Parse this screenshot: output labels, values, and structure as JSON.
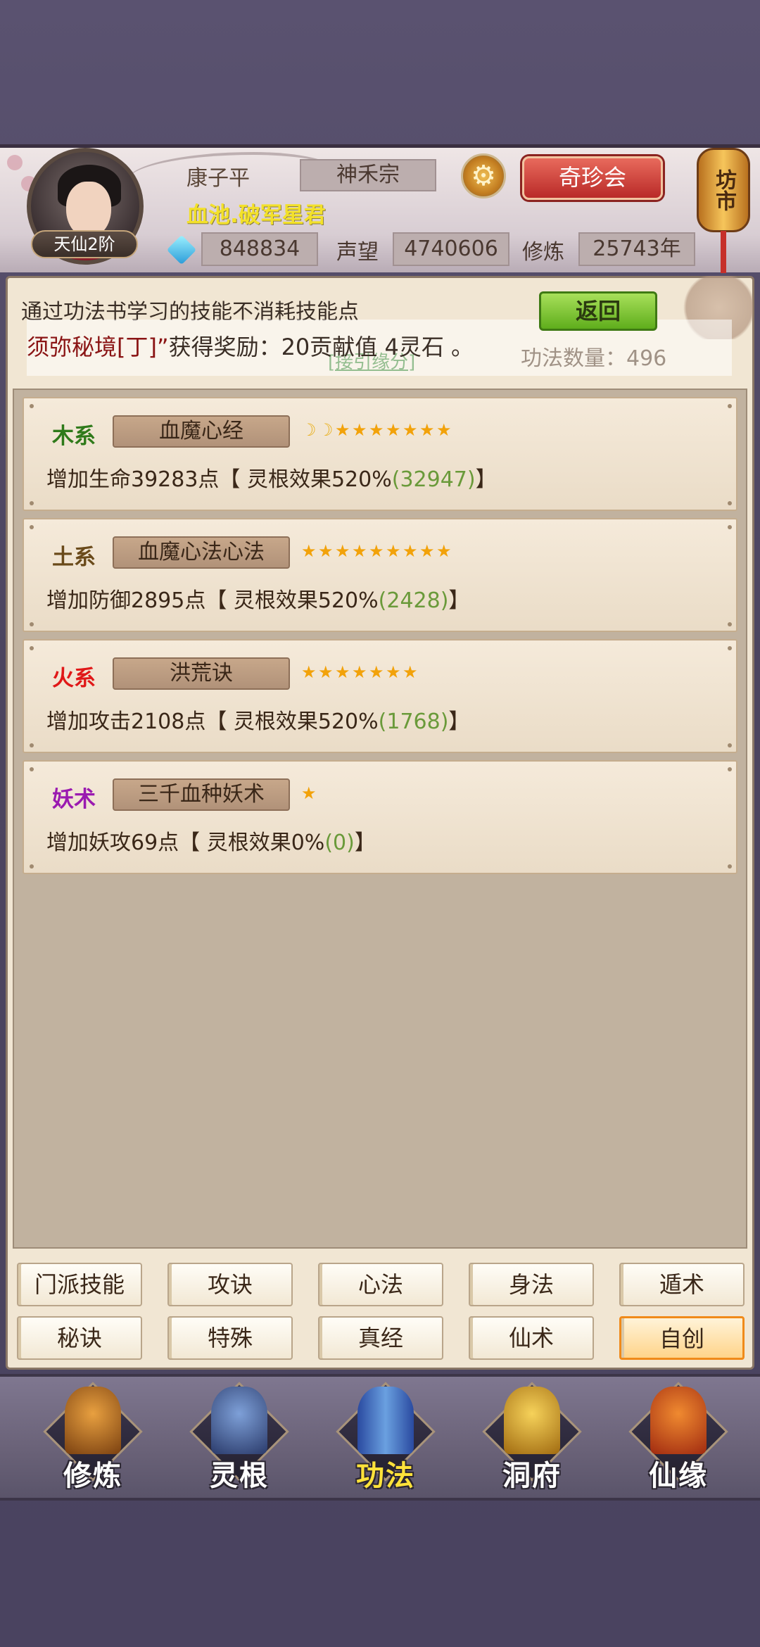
{
  "player": {
    "name": "康子平",
    "sect": "神禾宗",
    "title": "血池.破军星君",
    "rank": "天仙2阶",
    "spirit_stones": "848834",
    "reputation_label": "声望",
    "reputation": "4740606",
    "cultivation_label": "修炼",
    "cultivation_years": "25743年"
  },
  "header": {
    "treasure_button": "奇珍会",
    "market_label": "坊市"
  },
  "panel": {
    "notice": "通过功法书学习的技能不消耗技能点",
    "back_button": "返回",
    "ticker_main": "须弥秘境[丁]”",
    "ticker_tail": "获得奖励：20贡献值 4灵石 。",
    "ticker_link": "[接引缘分]",
    "skill_count": "功法数量：496"
  },
  "skills": [
    {
      "element": "木系",
      "element_color": "#2f7a1a",
      "name": "血魔心经",
      "moons": 2,
      "stars": 7,
      "effect": "增加生命39283点【 灵根效果520%",
      "bonus": "(32947)",
      "effect_end": "】"
    },
    {
      "element": "土系",
      "element_color": "#6a4a1a",
      "name": "血魔心法心法",
      "moons": 0,
      "stars": 9,
      "effect": "增加防御2895点【 灵根效果520%",
      "bonus": "(2428)",
      "effect_end": "】"
    },
    {
      "element": "火系",
      "element_color": "#e01818",
      "name": "洪荒诀",
      "moons": 0,
      "stars": 7,
      "effect": "增加攻击2108点【 灵根效果520%",
      "bonus": "(1768)",
      "effect_end": "】"
    },
    {
      "element": "妖术",
      "element_color": "#9a1ab0",
      "name": "三千血种妖术",
      "moons": 0,
      "stars": 1,
      "effect": "增加妖攻69点【 灵根效果0%",
      "bonus": "(0)",
      "effect_end": "】"
    }
  ],
  "categories": [
    {
      "label": "门派技能",
      "active": false
    },
    {
      "label": "攻诀",
      "active": false
    },
    {
      "label": "心法",
      "active": false
    },
    {
      "label": "身法",
      "active": false
    },
    {
      "label": "遁术",
      "active": false
    },
    {
      "label": "秘诀",
      "active": false
    },
    {
      "label": "特殊",
      "active": false
    },
    {
      "label": "真经",
      "active": false
    },
    {
      "label": "仙术",
      "active": false
    },
    {
      "label": "自创",
      "active": true
    }
  ],
  "nav": [
    {
      "label": "修炼",
      "icon": "cultivator-icon",
      "active": false
    },
    {
      "label": "灵根",
      "icon": "spirit-root-icon",
      "active": false
    },
    {
      "label": "功法",
      "icon": "skill-book-icon",
      "active": true
    },
    {
      "label": "洞府",
      "icon": "cave-mansion-icon",
      "active": false
    },
    {
      "label": "仙缘",
      "icon": "gourd-icon",
      "active": false
    }
  ]
}
